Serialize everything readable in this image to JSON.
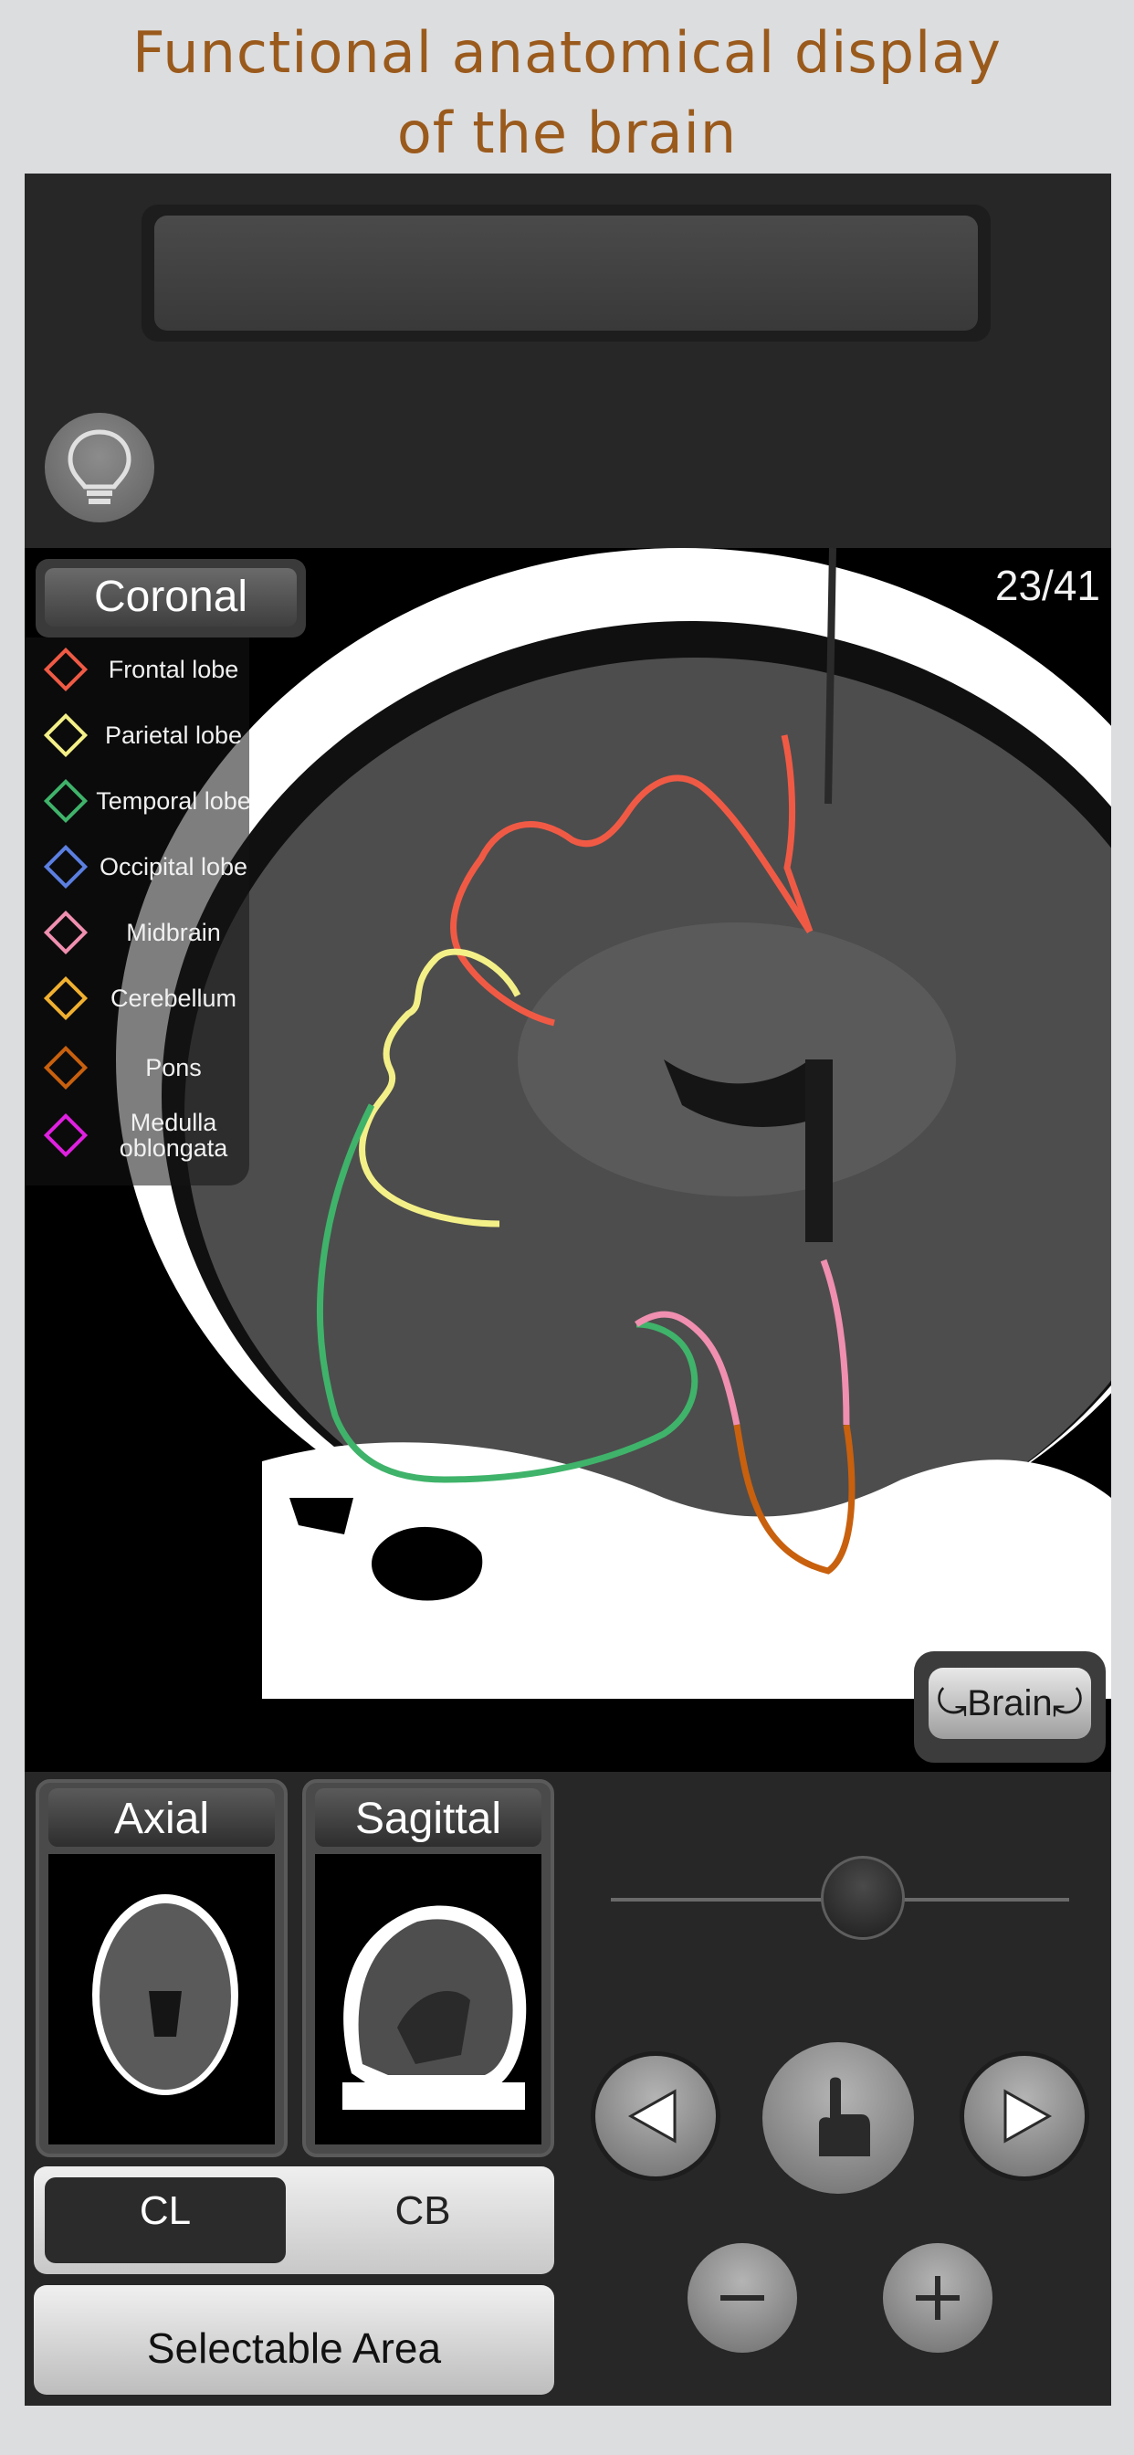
{
  "page": {
    "title_line1": "Functional anatomical display",
    "title_line2": "of the brain"
  },
  "message_box": {
    "text": ""
  },
  "viewer": {
    "plane": "Coronal",
    "slice_counter": "23/41",
    "brain_button": "⤿Brain⤾",
    "legend": [
      {
        "label": "Frontal lobe",
        "color": "#f05a45"
      },
      {
        "label": "Parietal lobe",
        "color": "#f4f088"
      },
      {
        "label": "Temporal lobe",
        "color": "#3fb36a"
      },
      {
        "label": "Occipital lobe",
        "color": "#5b7fe0"
      },
      {
        "label": "Midbrain",
        "color": "#f08fb0"
      },
      {
        "label": "Cerebellum",
        "color": "#f0b030"
      },
      {
        "label": "Pons",
        "color": "#c8600e"
      },
      {
        "label": "Medulla oblongata",
        "color": "#e020e0"
      }
    ]
  },
  "thumbnails": {
    "axial_label": "Axial",
    "sagittal_label": "Sagittal"
  },
  "segmented": {
    "option_cl": "CL",
    "option_cb": "CB",
    "selected": "CL"
  },
  "selectable_area_label": "Selectable Area",
  "slice_slider": {
    "value": 23,
    "max": 41
  }
}
